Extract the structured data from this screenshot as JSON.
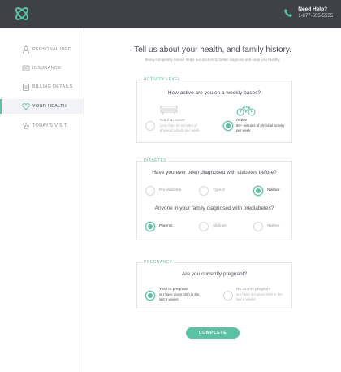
{
  "header": {
    "help_title": "Need Help?",
    "help_phone": "1-877-555-5555"
  },
  "sidebar": {
    "items": [
      {
        "label": "PERSONAL INFO",
        "icon": "person-icon"
      },
      {
        "label": "INSURANCE",
        "icon": "insurance-card-icon"
      },
      {
        "label": "BILLING DETAILS",
        "icon": "clipboard-icon"
      },
      {
        "label": "YOUR HEALTH",
        "icon": "heart-icon",
        "active": true
      },
      {
        "label": "TODAY'S VISIT",
        "icon": "stethoscope-icon"
      }
    ]
  },
  "main": {
    "title": "Tell us about your health, and family history.",
    "subtitle": "Being completely honest helps our doctors to better diagnose and keep you healthy.",
    "activity": {
      "label": "ACTIVITY LEVEL",
      "question": "How active are you on a weekly bases?",
      "options": [
        {
          "title": "Not that active",
          "desc": "Less than 60 minutes of physical activity per week",
          "selected": false
        },
        {
          "title": "Active",
          "desc": "60+ minutes of physical activity per week",
          "selected": true
        }
      ]
    },
    "diabetes": {
      "label": "DIABETES",
      "question1": "Have you ever been diagnosed with diabetes before?",
      "options1": [
        {
          "title": "Pre-diabetes",
          "selected": false
        },
        {
          "title": "Type-2",
          "selected": false
        },
        {
          "title": "Neither",
          "selected": true
        }
      ],
      "question2": "Anyone in your family diagnosed with prediabetes?",
      "options2": [
        {
          "title": "Parents",
          "selected": true
        },
        {
          "title": "Siblings",
          "selected": false
        },
        {
          "title": "Neither",
          "selected": false
        }
      ]
    },
    "pregnancy": {
      "label": "PREGNANCY",
      "question": "Are you currently pregnant?",
      "options": [
        {
          "title": "Yes I'm pregnant",
          "desc": "or I have given birth in the last 6 weeks",
          "selected": true
        },
        {
          "title": "No I'm not pregnant",
          "desc": "or I have not given birth in the last 6 weeks",
          "selected": false
        }
      ]
    },
    "complete_label": "COMPLETE"
  },
  "colors": {
    "accent": "#5cc0a3",
    "topbar": "#3f4149"
  }
}
